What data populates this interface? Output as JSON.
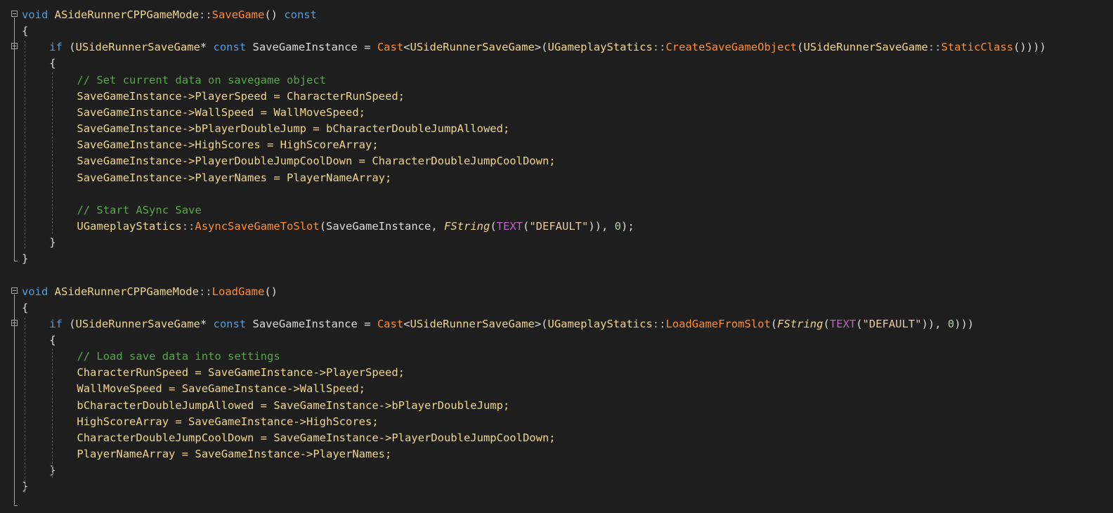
{
  "colors": {
    "background": "#1e1e1e",
    "keyword": "#569cd6",
    "type": "#f0d58a",
    "function": "#ff8c2e",
    "comment": "#57a64a",
    "string": "#e8c9a0",
    "macro": "#bd63c5",
    "number": "#b5cea8",
    "text": "#dadada"
  },
  "lines": [
    {
      "fold": true,
      "indent": 0,
      "tokens": [
        {
          "t": "void",
          "c": "kw"
        },
        {
          "t": " ",
          "c": "tx"
        },
        {
          "t": "ASideRunnerCPPGameMode",
          "c": "ty"
        },
        {
          "t": "::",
          "c": "op"
        },
        {
          "t": "SaveGame",
          "c": "fn"
        },
        {
          "t": "() ",
          "c": "tx"
        },
        {
          "t": "const",
          "c": "kw"
        }
      ]
    },
    {
      "fold": false,
      "indent": 0,
      "tokens": [
        {
          "t": "{",
          "c": "tx"
        }
      ]
    },
    {
      "fold": true,
      "indent": 1,
      "tokens": [
        {
          "t": "if",
          "c": "kw"
        },
        {
          "t": " (",
          "c": "tx"
        },
        {
          "t": "USideRunnerSaveGame",
          "c": "ty"
        },
        {
          "t": "* ",
          "c": "tx"
        },
        {
          "t": "const",
          "c": "kw"
        },
        {
          "t": " SaveGameInstance = ",
          "c": "tx"
        },
        {
          "t": "Cast",
          "c": "fn"
        },
        {
          "t": "<",
          "c": "tx"
        },
        {
          "t": "USideRunnerSaveGame",
          "c": "ty"
        },
        {
          "t": ">(",
          "c": "tx"
        },
        {
          "t": "UGameplayStatics",
          "c": "ty"
        },
        {
          "t": "::",
          "c": "op"
        },
        {
          "t": "CreateSaveGameObject",
          "c": "fn"
        },
        {
          "t": "(",
          "c": "tx"
        },
        {
          "t": "USideRunnerSaveGame",
          "c": "ty"
        },
        {
          "t": "::",
          "c": "op"
        },
        {
          "t": "StaticClass",
          "c": "fn"
        },
        {
          "t": "())))",
          "c": "tx"
        }
      ]
    },
    {
      "fold": false,
      "indent": 1,
      "tokens": [
        {
          "t": "{",
          "c": "tx"
        }
      ]
    },
    {
      "fold": false,
      "indent": 2,
      "tokens": [
        {
          "t": "// Set current data on savegame object",
          "c": "com"
        }
      ]
    },
    {
      "fold": false,
      "indent": 2,
      "tokens": [
        {
          "t": "SaveGameInstance->PlayerSpeed = CharacterRunSpeed;",
          "c": "ty"
        }
      ]
    },
    {
      "fold": false,
      "indent": 2,
      "tokens": [
        {
          "t": "SaveGameInstance->WallSpeed = WallMoveSpeed;",
          "c": "ty"
        }
      ]
    },
    {
      "fold": false,
      "indent": 2,
      "tokens": [
        {
          "t": "SaveGameInstance->bPlayerDoubleJump = bCharacterDoubleJumpAllowed;",
          "c": "ty"
        }
      ]
    },
    {
      "fold": false,
      "indent": 2,
      "tokens": [
        {
          "t": "SaveGameInstance->HighScores = HighScoreArray;",
          "c": "ty"
        }
      ]
    },
    {
      "fold": false,
      "indent": 2,
      "tokens": [
        {
          "t": "SaveGameInstance->PlayerDoubleJumpCoolDown = CharacterDoubleJumpCoolDown;",
          "c": "ty"
        }
      ]
    },
    {
      "fold": false,
      "indent": 2,
      "tokens": [
        {
          "t": "SaveGameInstance->PlayerNames = PlayerNameArray;",
          "c": "ty"
        }
      ]
    },
    {
      "fold": false,
      "indent": 2,
      "tokens": []
    },
    {
      "fold": false,
      "indent": 2,
      "tokens": [
        {
          "t": "// Start ASync Save",
          "c": "com"
        }
      ]
    },
    {
      "fold": false,
      "indent": 2,
      "tokens": [
        {
          "t": "UGameplayStatics",
          "c": "ty"
        },
        {
          "t": "::",
          "c": "op"
        },
        {
          "t": "AsyncSaveGameToSlot",
          "c": "fn"
        },
        {
          "t": "(SaveGameInstance, ",
          "c": "tx"
        },
        {
          "t": "FString",
          "c": "it"
        },
        {
          "t": "(",
          "c": "tx"
        },
        {
          "t": "TEXT",
          "c": "mac"
        },
        {
          "t": "(",
          "c": "tx"
        },
        {
          "t": "\"DEFAULT\"",
          "c": "str"
        },
        {
          "t": ")), ",
          "c": "tx"
        },
        {
          "t": "0",
          "c": "num"
        },
        {
          "t": ");",
          "c": "tx"
        }
      ]
    },
    {
      "fold": false,
      "indent": 1,
      "tokens": [
        {
          "t": "}",
          "c": "tx"
        }
      ]
    },
    {
      "fold": false,
      "indent": 0,
      "tokens": [
        {
          "t": "}",
          "c": "tx"
        }
      ]
    },
    {
      "fold": false,
      "indent": 0,
      "tokens": []
    },
    {
      "fold": true,
      "indent": 0,
      "tokens": [
        {
          "t": "void",
          "c": "kw"
        },
        {
          "t": " ",
          "c": "tx"
        },
        {
          "t": "ASideRunnerCPPGameMode",
          "c": "ty"
        },
        {
          "t": "::",
          "c": "op"
        },
        {
          "t": "LoadGame",
          "c": "fn"
        },
        {
          "t": "()",
          "c": "tx"
        }
      ]
    },
    {
      "fold": false,
      "indent": 0,
      "tokens": [
        {
          "t": "{",
          "c": "tx"
        }
      ]
    },
    {
      "fold": true,
      "indent": 1,
      "tokens": [
        {
          "t": "if",
          "c": "kw"
        },
        {
          "t": " (",
          "c": "tx"
        },
        {
          "t": "USideRunnerSaveGame",
          "c": "ty"
        },
        {
          "t": "* ",
          "c": "tx"
        },
        {
          "t": "const",
          "c": "kw"
        },
        {
          "t": " SaveGameInstance = ",
          "c": "tx"
        },
        {
          "t": "Cast",
          "c": "fn"
        },
        {
          "t": "<",
          "c": "tx"
        },
        {
          "t": "USideRunnerSaveGame",
          "c": "ty"
        },
        {
          "t": ">(",
          "c": "tx"
        },
        {
          "t": "UGameplayStatics",
          "c": "ty"
        },
        {
          "t": "::",
          "c": "op"
        },
        {
          "t": "LoadGameFromSlot",
          "c": "fn"
        },
        {
          "t": "(",
          "c": "tx"
        },
        {
          "t": "FString",
          "c": "it"
        },
        {
          "t": "(",
          "c": "tx"
        },
        {
          "t": "TEXT",
          "c": "mac"
        },
        {
          "t": "(",
          "c": "tx"
        },
        {
          "t": "\"DEFAULT\"",
          "c": "str"
        },
        {
          "t": ")), ",
          "c": "tx"
        },
        {
          "t": "0",
          "c": "num"
        },
        {
          "t": ")))",
          "c": "tx"
        }
      ]
    },
    {
      "fold": false,
      "indent": 1,
      "tokens": [
        {
          "t": "{",
          "c": "tx"
        }
      ]
    },
    {
      "fold": false,
      "indent": 2,
      "tokens": [
        {
          "t": "// Load save data into settings",
          "c": "com"
        }
      ]
    },
    {
      "fold": false,
      "indent": 2,
      "tokens": [
        {
          "t": "CharacterRunSpeed = SaveGameInstance->PlayerSpeed;",
          "c": "ty"
        }
      ]
    },
    {
      "fold": false,
      "indent": 2,
      "tokens": [
        {
          "t": "WallMoveSpeed = SaveGameInstance->WallSpeed;",
          "c": "ty"
        }
      ]
    },
    {
      "fold": false,
      "indent": 2,
      "tokens": [
        {
          "t": "bCharacterDoubleJumpAllowed = SaveGameInstance->bPlayerDoubleJump;",
          "c": "ty"
        }
      ]
    },
    {
      "fold": false,
      "indent": 2,
      "tokens": [
        {
          "t": "HighScoreArray = SaveGameInstance->HighScores;",
          "c": "ty"
        }
      ]
    },
    {
      "fold": false,
      "indent": 2,
      "tokens": [
        {
          "t": "CharacterDoubleJumpCoolDown = SaveGameInstance->PlayerDoubleJumpCoolDown;",
          "c": "ty"
        }
      ]
    },
    {
      "fold": false,
      "indent": 2,
      "tokens": [
        {
          "t": "PlayerNameArray = SaveGameInstance->PlayerNames;",
          "c": "ty"
        }
      ]
    },
    {
      "fold": false,
      "indent": 1,
      "tokens": [
        {
          "t": "}",
          "c": "tx"
        }
      ]
    },
    {
      "fold": false,
      "indent": 0,
      "tokens": [
        {
          "t": "}",
          "c": "tx"
        }
      ]
    }
  ]
}
